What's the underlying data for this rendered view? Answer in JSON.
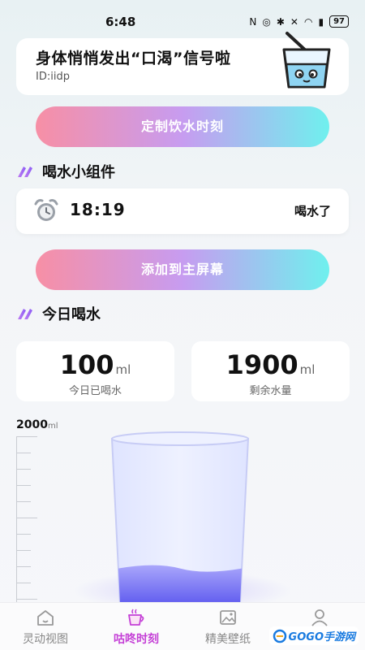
{
  "status_bar": {
    "time": "6:48",
    "battery": "97"
  },
  "hero": {
    "title": "身体悄悄发出“口渴”信号啦",
    "subtitle": "ID:iidp"
  },
  "buttons": {
    "customize": "定制饮水时刻",
    "add_home": "添加到主屏幕"
  },
  "sections": {
    "widget": "喝水小组件",
    "today": "今日喝水"
  },
  "widget": {
    "time": "18:19",
    "message": "喝水了"
  },
  "stats": {
    "drunk": {
      "value": "100",
      "unit": "ml",
      "label": "今日已喝水"
    },
    "remaining": {
      "value": "1900",
      "unit": "ml",
      "label": "剩余水量"
    }
  },
  "gauge": {
    "max": "2000",
    "unit": "ml",
    "fill_fraction": 0.05
  },
  "tabs": [
    {
      "label": "灵动视图",
      "icon": "home-icon"
    },
    {
      "label": "咕咚时刻",
      "icon": "cup-icon"
    },
    {
      "label": "精美壁纸",
      "icon": "image-icon"
    },
    {
      "label": "",
      "icon": "profile-icon"
    }
  ],
  "watermark": {
    "text": "GOGO手游网"
  },
  "colors": {
    "accent": "#c43fd6",
    "gradient_start": "#f78fa5",
    "gradient_end": "#6ff0ee",
    "water": "#6f6cf5"
  }
}
